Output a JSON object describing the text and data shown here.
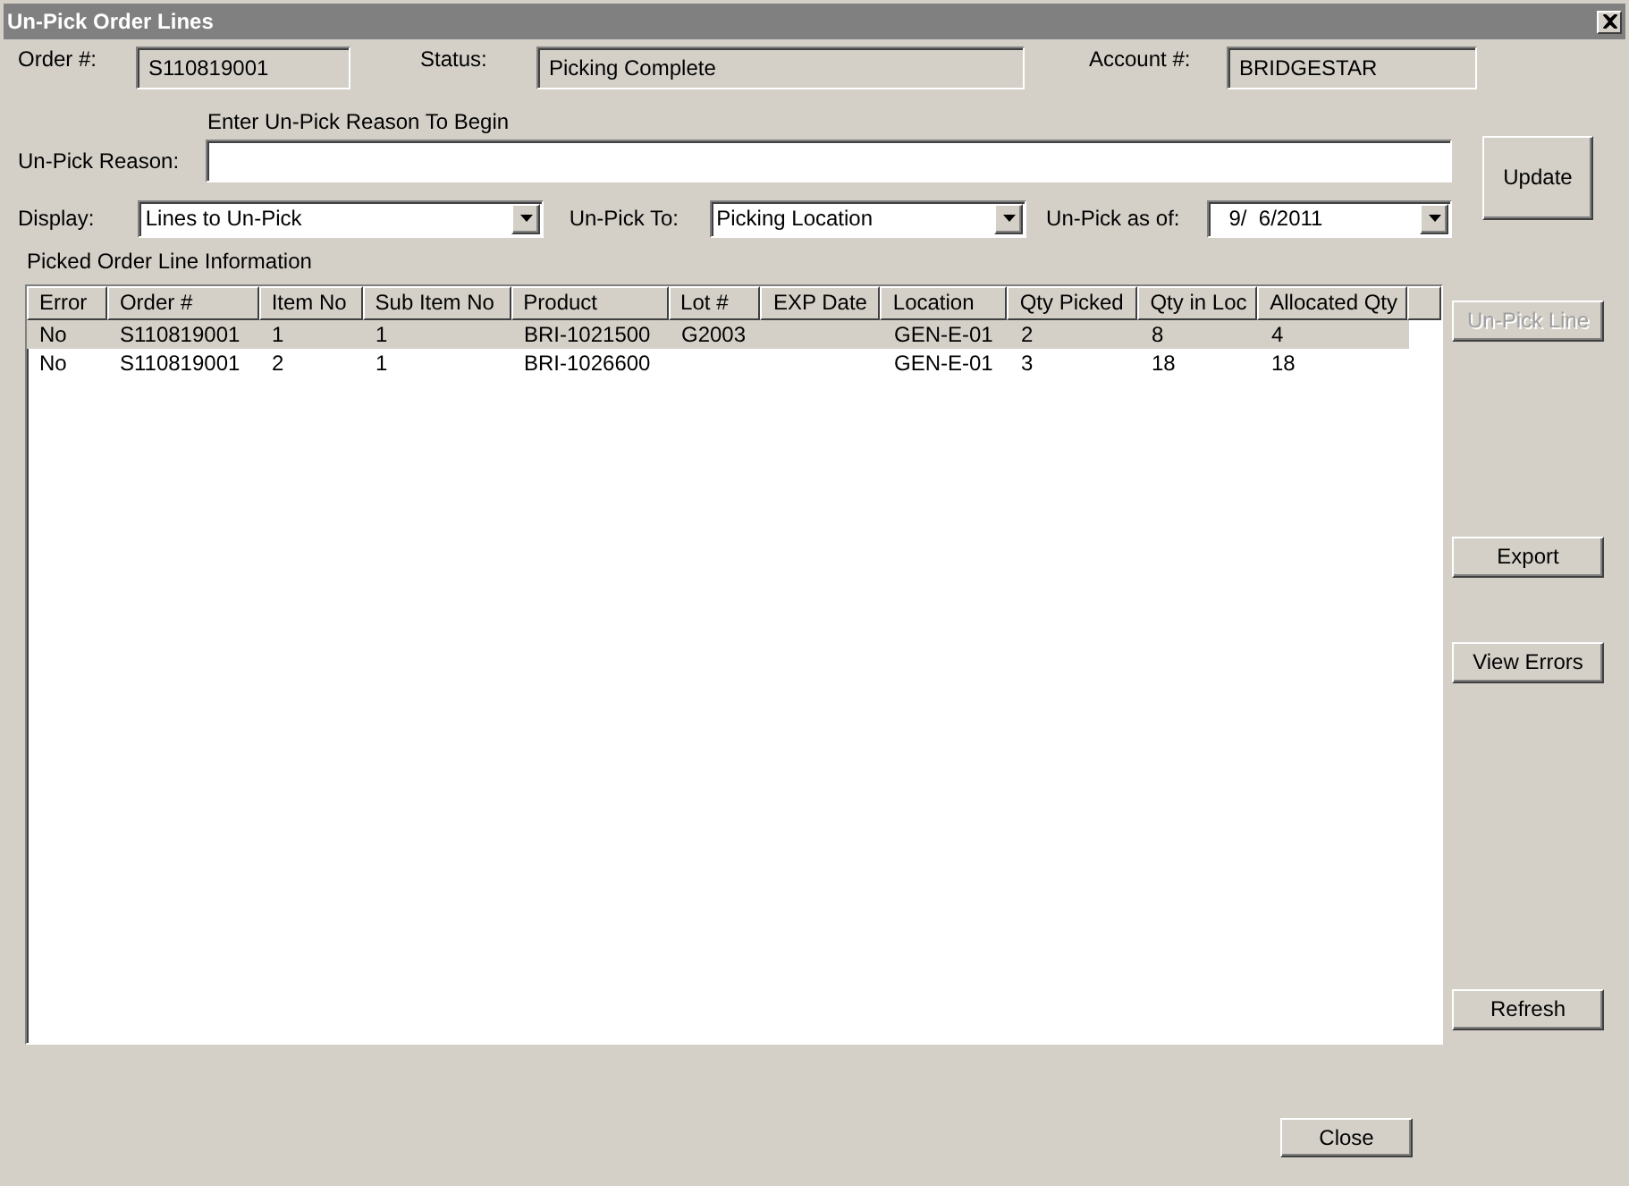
{
  "window": {
    "title": "Un-Pick Order Lines"
  },
  "header": [
    {
      "label": "Order #:",
      "value": "S110819001"
    },
    {
      "label": "Status:",
      "value": "Picking Complete"
    },
    {
      "label": "Account #:",
      "value": "BRIDGESTAR"
    }
  ],
  "reason": {
    "hint": "Enter Un-Pick Reason To Begin",
    "label": "Un-Pick Reason:"
  },
  "filters": [
    {
      "label": "Display:",
      "value": "Lines to Un-Pick"
    },
    {
      "label": "Un-Pick To:",
      "value": "Picking Location"
    },
    {
      "label": "Un-Pick as of:",
      "value": "9/  6/2011"
    }
  ],
  "update_button": {
    "label": "Update",
    "disabled": false
  },
  "table": {
    "caption": "Picked Order Line Information",
    "columns": [
      "Error",
      "Order #",
      "Item No",
      "Sub Item No",
      "Product",
      "Lot #",
      "EXP Date",
      "Location",
      "Qty Picked",
      "Qty in Loc",
      "Allocated Qty"
    ],
    "rows": [
      {
        "selected": true,
        "cells": [
          "No",
          "S110819001",
          "1",
          "1",
          "BRI-1021500",
          "G2003",
          "",
          "GEN-E-01",
          "2",
          "8",
          "4"
        ]
      },
      {
        "selected": false,
        "cells": [
          "No",
          "S110819001",
          "2",
          "1",
          "BRI-1026600",
          "",
          "",
          "GEN-E-01",
          "3",
          "18",
          "18"
        ]
      }
    ]
  },
  "side_buttons": [
    {
      "label": "Un-Pick Line",
      "disabled": true
    },
    {
      "label": "Export",
      "disabled": false
    },
    {
      "label": "View Errors",
      "disabled": false
    },
    {
      "label": "Refresh",
      "disabled": false
    }
  ],
  "close_button": {
    "label": "Close",
    "disabled": false
  }
}
